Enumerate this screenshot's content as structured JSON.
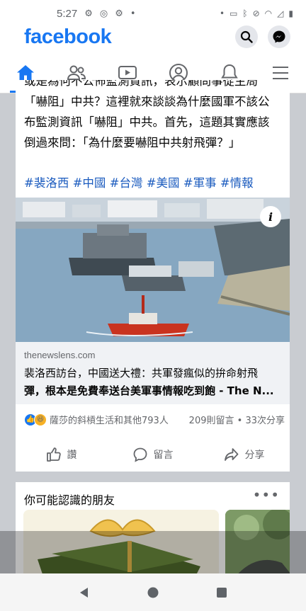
{
  "status_bar": {
    "time": "5:27",
    "left_icons": [
      "android-debug-icon",
      "sync-icon",
      "android-icon",
      "dot-icon"
    ],
    "right_icons": [
      "dot-icon",
      "cast-icon",
      "bluetooth-icon",
      "vibrate-off-icon",
      "wifi-icon",
      "no-signal-icon",
      "battery-icon"
    ]
  },
  "app": {
    "name": "facebook",
    "brand_color": "#1877f2"
  },
  "header_actions": [
    "search-icon",
    "messenger-icon"
  ],
  "nav_tabs": [
    {
      "name": "home-icon",
      "active": true
    },
    {
      "name": "friends-icon",
      "active": false
    },
    {
      "name": "watch-icon",
      "active": false
    },
    {
      "name": "profile-icon",
      "active": false
    },
    {
      "name": "notifications-icon",
      "active": false
    },
    {
      "name": "menu-icon",
      "active": false
    }
  ],
  "post": {
    "text_lines": [
      "或是為何不公佈監測資訊，表示顧問事從主局",
      "「嚇阻」中共？這裡就來談談為什麼國軍不該公",
      "布監測資訊「嚇阻」中共。首先，這題其實應該",
      "倒過來問：「為什麼要嚇阻中共射飛彈？」"
    ],
    "hashtags": "#裴洛西 #中國 #台灣 #美國 #軍事 #情報",
    "link": {
      "domain": "thenewslens.com",
      "title_lines": [
        "裴洛西訪台，中國送大禮：共軍發瘋似的拚命射飛",
        "彈，根本是免費奉送台美軍事情報吃到飽 - The N..."
      ],
      "info_label": "i"
    },
    "reactions": {
      "types": [
        "like",
        "haha"
      ],
      "summary": "薩莎的斜槓生活和其他793人",
      "comments": "209則留言",
      "separator": "•",
      "shares": "33次分享"
    },
    "actions": [
      {
        "icon": "thumbs-up-icon",
        "label": "讚"
      },
      {
        "icon": "comment-icon",
        "label": "留言"
      },
      {
        "icon": "share-icon",
        "label": "分享"
      }
    ]
  },
  "pymk": {
    "title": "你可能認識的朋友",
    "more": "•••"
  },
  "android_nav": [
    "back-icon",
    "home-circle-icon",
    "recents-icon"
  ]
}
